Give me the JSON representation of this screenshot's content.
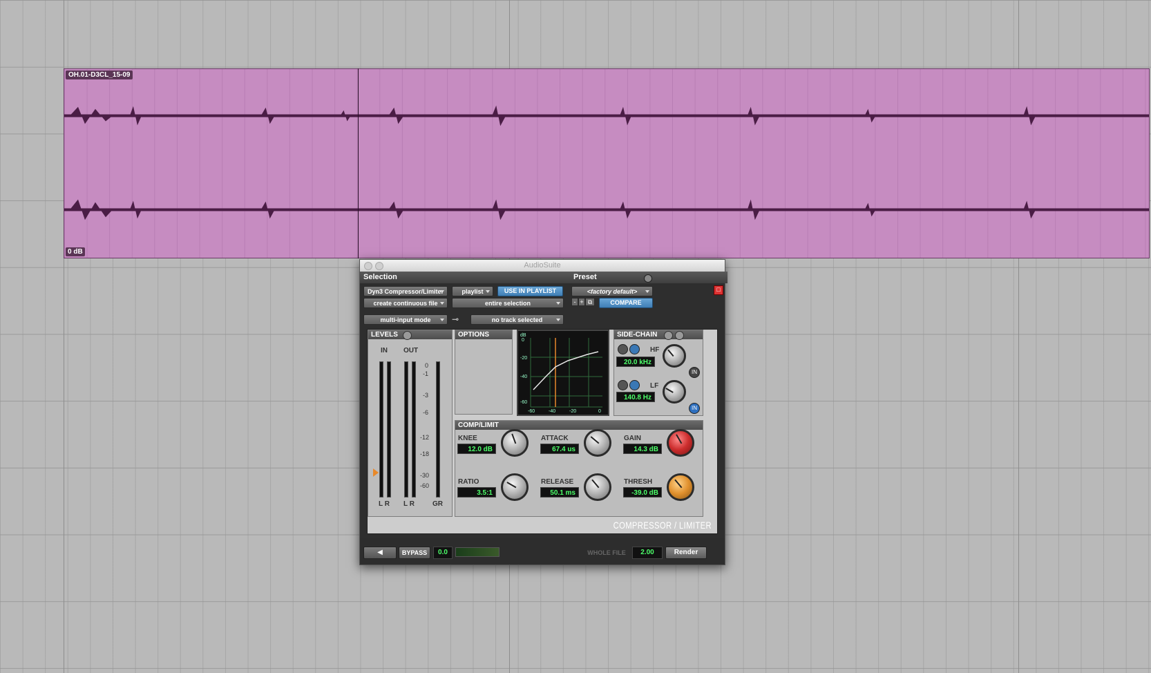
{
  "clip": {
    "name": "OH.01-D3CL_15-09",
    "gain": "0 dB"
  },
  "window": {
    "title": "AudioSuite"
  },
  "selection": {
    "header": "Selection",
    "plugin": "Dyn3 Compressor/Limiter",
    "playlist": "playlist",
    "use_in_playlist": "USE IN PLAYLIST",
    "file_mode": "create continuous file",
    "scope": "entire selection",
    "input_mode": "multi-input mode",
    "sidechain_track": "no track selected"
  },
  "preset": {
    "header": "Preset",
    "name": "<factory default>",
    "minus": "-",
    "plus": "+",
    "compare": "COMPARE"
  },
  "levels": {
    "title": "LEVELS",
    "in_label": "IN",
    "out_label": "OUT",
    "scale": [
      "0",
      "-1",
      "-3",
      "-6",
      "-12",
      "-18",
      "-30",
      "-60"
    ],
    "in_lr": "L R",
    "out_lr": "L R",
    "gr": "GR"
  },
  "options": {
    "title": "OPTIONS"
  },
  "graph": {
    "y_ticks": [
      "dB",
      "0",
      "-20",
      "-40",
      "-60"
    ],
    "x_ticks": [
      "-60",
      "-40",
      "-20",
      "0"
    ]
  },
  "sidechain": {
    "title": "SIDE-CHAIN",
    "hf_label": "HF",
    "hf_value": "20.0 kHz",
    "lf_label": "LF",
    "lf_value": "140.8 Hz",
    "in_label": "IN"
  },
  "comp": {
    "title": "COMP/LIMIT",
    "knee_label": "KNEE",
    "knee_value": "12.0 dB",
    "attack_label": "ATTACK",
    "attack_value": "67.4 us",
    "gain_label": "GAIN",
    "gain_value": "14.3 dB",
    "ratio_label": "RATIO",
    "ratio_value": "3.5:1",
    "release_label": "RELEASE",
    "release_value": "50.1 ms",
    "thresh_label": "THRESH",
    "thresh_value": "-39.0 dB"
  },
  "branding": "COMPRESSOR / LIMITER",
  "footer": {
    "bypass": "BYPASS",
    "level": "0.0",
    "whole_file": "WHOLE FILE",
    "handle": "2.00",
    "render": "Render"
  }
}
